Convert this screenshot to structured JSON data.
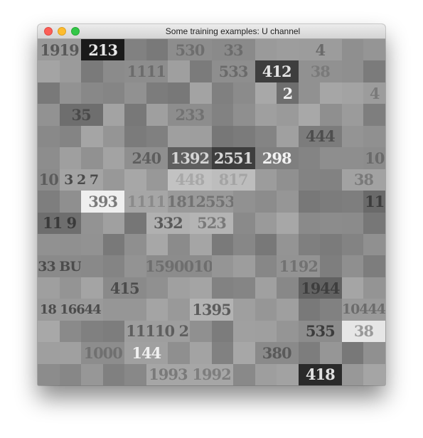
{
  "window": {
    "title": "Some training examples: U channel"
  },
  "mosaic": {
    "grid": {
      "rows": 16,
      "cols": 16
    },
    "tiles": [
      {
        "row": 0,
        "col": 0,
        "span": 2,
        "label": "1919",
        "bg": "#9a9a9a",
        "fg": "#585858"
      },
      {
        "row": 0,
        "col": 2,
        "span": 2,
        "label": "213",
        "bg": "#1a1a1a",
        "fg": "#e8e8e8"
      },
      {
        "row": 0,
        "col": 6,
        "span": 2,
        "label": "530",
        "bg": "#8d8d8d",
        "fg": "#6e6e6e"
      },
      {
        "row": 0,
        "col": 8,
        "span": 2,
        "label": "33",
        "bg": "#8a8a8a",
        "fg": "#6c6c6c"
      },
      {
        "row": 0,
        "col": 12,
        "span": 2,
        "label": "4",
        "bg": "#9c9c9c",
        "fg": "#6a6a6a"
      },
      {
        "row": 1,
        "col": 4,
        "span": 2,
        "label": "1111",
        "bg": "#8d8d8d",
        "fg": "#6c6c6c"
      },
      {
        "row": 1,
        "col": 8,
        "span": 2,
        "label": "533",
        "bg": "#8e8e8e",
        "fg": "#6a6a6a"
      },
      {
        "row": 1,
        "col": 10,
        "span": 2,
        "label": "412",
        "bg": "#3e3e3e",
        "fg": "#e4e4e4"
      },
      {
        "row": 1,
        "col": 12,
        "span": 2,
        "label": "38",
        "bg": "#919191",
        "fg": "#7a7a7a"
      },
      {
        "row": 2,
        "col": 11,
        "span": 1,
        "label": "2",
        "bg": "#6e6e6e",
        "fg": "#f2f2f2"
      },
      {
        "row": 2,
        "col": 15,
        "span": 1,
        "label": "4",
        "bg": "#9c9c9c",
        "fg": "#7a7a7a"
      },
      {
        "row": 3,
        "col": 1,
        "span": 2,
        "label": "35",
        "bg": "#6e6e6e",
        "fg": "#4a4a4a"
      },
      {
        "row": 3,
        "col": 6,
        "span": 2,
        "label": "233",
        "bg": "#8d8d8d",
        "fg": "#727272"
      },
      {
        "row": 4,
        "col": 12,
        "span": 2,
        "label": "444",
        "bg": "#7c7c7c",
        "fg": "#4e4e4e"
      },
      {
        "row": 5,
        "col": 4,
        "span": 2,
        "label": "240",
        "bg": "#8f8f8f",
        "fg": "#5e5e5e"
      },
      {
        "row": 5,
        "col": 6,
        "span": 2,
        "label": "1392",
        "bg": "#5f5f5f",
        "fg": "#d4d4d4"
      },
      {
        "row": 5,
        "col": 8,
        "span": 2,
        "label": "2551",
        "bg": "#3e3e3e",
        "fg": "#d8d8d8"
      },
      {
        "row": 5,
        "col": 10,
        "span": 2,
        "label": "298",
        "bg": "#7f7f7f",
        "fg": "#f2f2f2"
      },
      {
        "row": 5,
        "col": 15,
        "span": 1,
        "label": "10",
        "bg": "#8c8c8c",
        "fg": "#6a6a6a"
      },
      {
        "row": 6,
        "col": 0,
        "span": 1,
        "label": "10",
        "bg": "#8b8b8b",
        "fg": "#5c5c5c"
      },
      {
        "row": 6,
        "col": 1,
        "span": 2,
        "label": "3 2 7",
        "bg": "#a4a4a4",
        "fg": "#4a4a4a"
      },
      {
        "row": 6,
        "col": 6,
        "span": 2,
        "label": "448",
        "bg": "#c2c2c2",
        "fg": "#a8a8a8"
      },
      {
        "row": 6,
        "col": 8,
        "span": 2,
        "label": "817",
        "bg": "#bdbdbd",
        "fg": "#a4a4a4"
      },
      {
        "row": 6,
        "col": 14,
        "span": 2,
        "label": "38",
        "bg": "#a2a2a2",
        "fg": "#7a7a7a"
      },
      {
        "row": 7,
        "col": 2,
        "span": 2,
        "label": "393",
        "bg": "#efefef",
        "fg": "#7a7a7a"
      },
      {
        "row": 7,
        "col": 4,
        "span": 2,
        "label": "1111",
        "bg": "#a6a6a6",
        "fg": "#8a8a8a"
      },
      {
        "row": 7,
        "col": 6,
        "span": 3,
        "label": "1812553",
        "bg": "#9a9a9a",
        "fg": "#727272"
      },
      {
        "row": 7,
        "col": 15,
        "span": 1,
        "label": "11",
        "bg": "#6a6a6a",
        "fg": "#3c3c3c"
      },
      {
        "row": 8,
        "col": 0,
        "span": 2,
        "label": "11 9",
        "bg": "#6e6e6e",
        "fg": "#3a3a3a"
      },
      {
        "row": 8,
        "col": 5,
        "span": 2,
        "label": "332",
        "bg": "#b0b0b0",
        "fg": "#5a5a5a"
      },
      {
        "row": 8,
        "col": 7,
        "span": 2,
        "label": "523",
        "bg": "#b4b4b4",
        "fg": "#7a7a7a"
      },
      {
        "row": 10,
        "col": 0,
        "span": 2,
        "label": "33 BU",
        "bg": "#8a8a8a",
        "fg": "#4c4c4c"
      },
      {
        "row": 10,
        "col": 5,
        "span": 3,
        "label": "1590010",
        "bg": "#8c8c8c",
        "fg": "#6e6e6e"
      },
      {
        "row": 10,
        "col": 11,
        "span": 2,
        "label": "1192",
        "bg": "#939393",
        "fg": "#727272"
      },
      {
        "row": 11,
        "col": 3,
        "span": 2,
        "label": "415",
        "bg": "#8a8a8a",
        "fg": "#4c4c4c"
      },
      {
        "row": 11,
        "col": 12,
        "span": 2,
        "label": "1944",
        "bg": "#626262",
        "fg": "#3e3e3e"
      },
      {
        "row": 12,
        "col": 0,
        "span": 3,
        "label": "18 16644",
        "bg": "#9a9a9a",
        "fg": "#4c4c4c"
      },
      {
        "row": 12,
        "col": 7,
        "span": 2,
        "label": "1395",
        "bg": "#b3b3b3",
        "fg": "#5c5c5c"
      },
      {
        "row": 12,
        "col": 14,
        "span": 2,
        "label": "10444",
        "bg": "#9a9a9a",
        "fg": "#6c6c6c"
      },
      {
        "row": 13,
        "col": 4,
        "span": 3,
        "label": "11110 2",
        "bg": "#9e9e9e",
        "fg": "#5e5e5e"
      },
      {
        "row": 13,
        "col": 12,
        "span": 2,
        "label": "535",
        "bg": "#8c8c8c",
        "fg": "#3c3c3c"
      },
      {
        "row": 13,
        "col": 14,
        "span": 2,
        "label": "38",
        "bg": "#e6e6e6",
        "fg": "#9a9a9a"
      },
      {
        "row": 14,
        "col": 2,
        "span": 2,
        "label": "1000",
        "bg": "#8d8d8d",
        "fg": "#707070"
      },
      {
        "row": 14,
        "col": 4,
        "span": 2,
        "label": "144",
        "bg": "#a0a0a0",
        "fg": "#f0f0f0"
      },
      {
        "row": 14,
        "col": 10,
        "span": 2,
        "label": "380",
        "bg": "#8a8a8a",
        "fg": "#5a5a5a"
      },
      {
        "row": 15,
        "col": 5,
        "span": 2,
        "label": "1993",
        "bg": "#a6a6a6",
        "fg": "#7a7a7a"
      },
      {
        "row": 15,
        "col": 7,
        "span": 2,
        "label": "1992",
        "bg": "#a6a6a6",
        "fg": "#7e7e7e"
      },
      {
        "row": 15,
        "col": 12,
        "span": 2,
        "label": "418",
        "bg": "#2a2a2a",
        "fg": "#e0e0e0"
      }
    ]
  }
}
